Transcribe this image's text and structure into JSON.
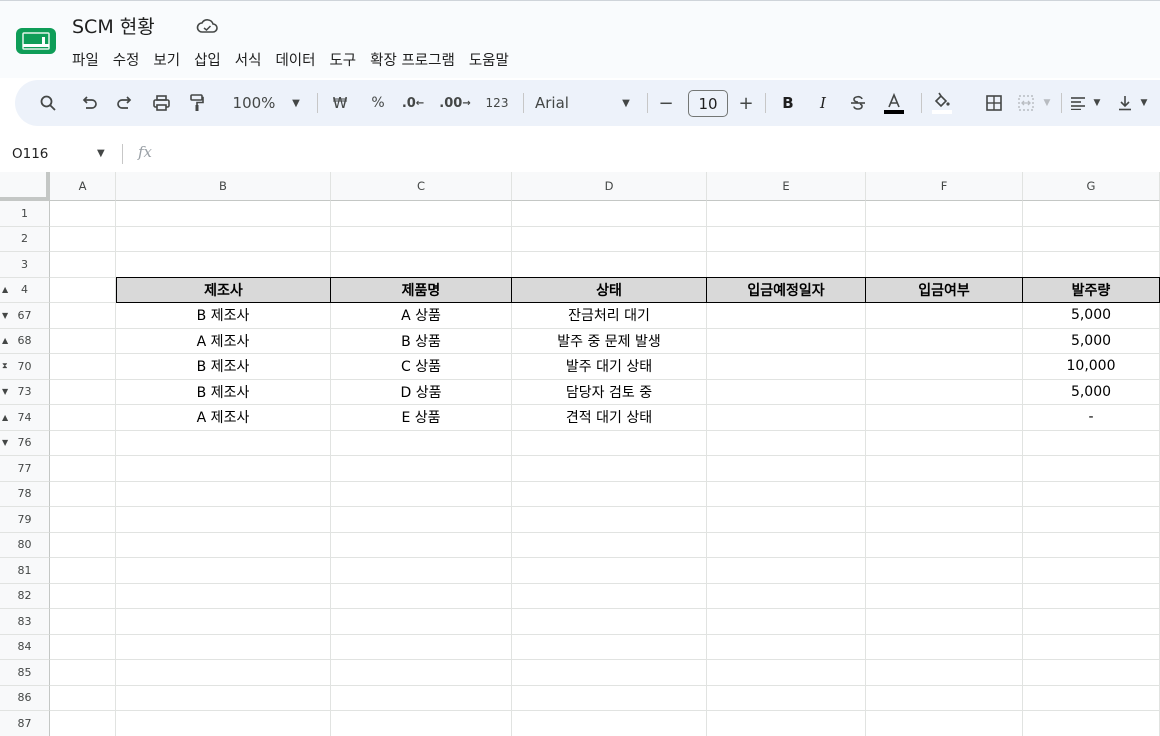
{
  "app": {
    "doc_title": "SCM 현황",
    "menu": [
      "파일",
      "수정",
      "보기",
      "삽입",
      "서식",
      "데이터",
      "도구",
      "확장 프로그램",
      "도움말"
    ]
  },
  "toolbar": {
    "zoom": "100%",
    "currency": "₩",
    "percent": "%",
    "decrease_decimal": ".0",
    "increase_decimal": ".00",
    "number_format": "123",
    "font": "Arial",
    "font_size": "10",
    "bold": "B",
    "italic": "I",
    "minus": "−",
    "plus": "+"
  },
  "formula_bar": {
    "name_box": "O116",
    "fx": "fx"
  },
  "columns": [
    "A",
    "B",
    "C",
    "D",
    "E",
    "F",
    "G"
  ],
  "rows": [
    {
      "num": "1",
      "arrow": ""
    },
    {
      "num": "2",
      "arrow": ""
    },
    {
      "num": "3",
      "arrow": ""
    },
    {
      "num": "4",
      "arrow": "▲"
    },
    {
      "num": "67",
      "arrow": "▼"
    },
    {
      "num": "68",
      "arrow": "▲"
    },
    {
      "num": "70",
      "arrow": "⧗"
    },
    {
      "num": "73",
      "arrow": "▼"
    },
    {
      "num": "74",
      "arrow": "▲"
    },
    {
      "num": "76",
      "arrow": "▼"
    },
    {
      "num": "77",
      "arrow": ""
    },
    {
      "num": "78",
      "arrow": ""
    },
    {
      "num": "79",
      "arrow": ""
    },
    {
      "num": "80",
      "arrow": ""
    },
    {
      "num": "81",
      "arrow": ""
    },
    {
      "num": "82",
      "arrow": ""
    },
    {
      "num": "83",
      "arrow": ""
    },
    {
      "num": "84",
      "arrow": ""
    },
    {
      "num": "85",
      "arrow": ""
    },
    {
      "num": "86",
      "arrow": ""
    },
    {
      "num": "87",
      "arrow": ""
    }
  ],
  "table": {
    "headers": [
      "제조사",
      "제품명",
      "상태",
      "입금예정일자",
      "입금여부",
      "발주량"
    ],
    "rows": [
      [
        "B 제조사",
        "A 상품",
        "잔금처리 대기",
        "",
        "",
        "5,000"
      ],
      [
        "A 제조사",
        "B 상품",
        "발주 중 문제 발생",
        "",
        "",
        "5,000"
      ],
      [
        "B 제조사",
        "C 상품",
        "발주 대기 상태",
        "",
        "",
        "10,000"
      ],
      [
        "B 제조사",
        "D 상품",
        "담당자 검토 중",
        "",
        "",
        "5,000"
      ],
      [
        "A 제조사",
        "E 상품",
        "견적 대기 상태",
        "",
        "",
        "-"
      ]
    ]
  },
  "colors": {
    "header_fill": "#d9d9d9",
    "toolbar_bg": "#edf2fa",
    "logo_green": "#0f9d58"
  }
}
